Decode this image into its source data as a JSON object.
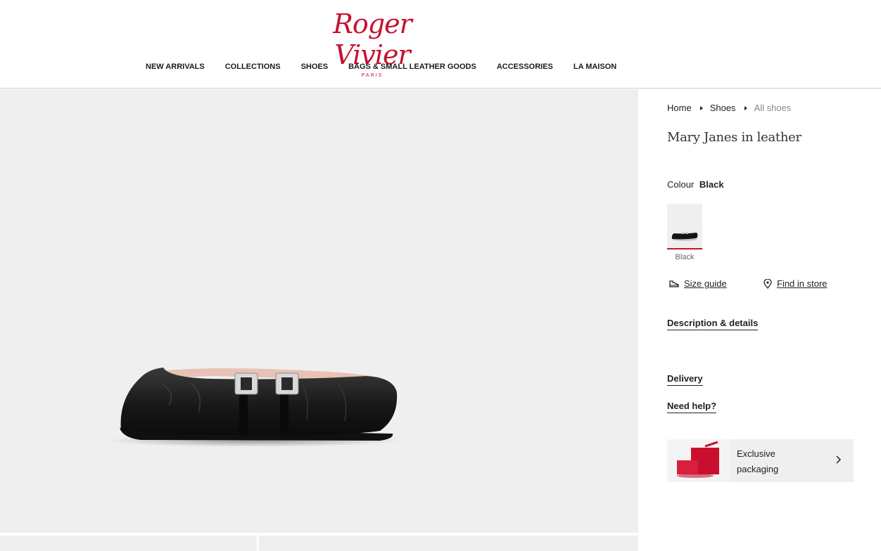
{
  "brand": {
    "logo_text": "Roger Vivier",
    "logo_sub": "PARIS",
    "color": "#c8102e"
  },
  "nav": {
    "items": [
      {
        "label": "NEW ARRIVALS"
      },
      {
        "label": "COLLECTIONS"
      },
      {
        "label": "SHOES"
      },
      {
        "label": "BAGS & SMALL LEATHER GOODS"
      },
      {
        "label": "ACCESSORIES"
      },
      {
        "label": "LA MAISON"
      }
    ]
  },
  "breadcrumb": {
    "items": [
      {
        "label": "Home"
      },
      {
        "label": "Shoes"
      },
      {
        "label": "All shoes"
      }
    ]
  },
  "product": {
    "title": "Mary Janes in leather",
    "colour_label": "Colour",
    "colour_value": "Black",
    "swatch_label": "Black"
  },
  "links": {
    "size_guide": "Size guide",
    "find_in_store": "Find in store"
  },
  "accordion": {
    "description": "Description & details",
    "delivery": "Delivery",
    "help": "Need help?"
  },
  "promo": {
    "text": "Exclusive packaging"
  },
  "icons": {
    "size_guide": "shoe-icon",
    "find_in_store": "location-pin-icon",
    "promo_arrow": "chevron-right-icon"
  }
}
